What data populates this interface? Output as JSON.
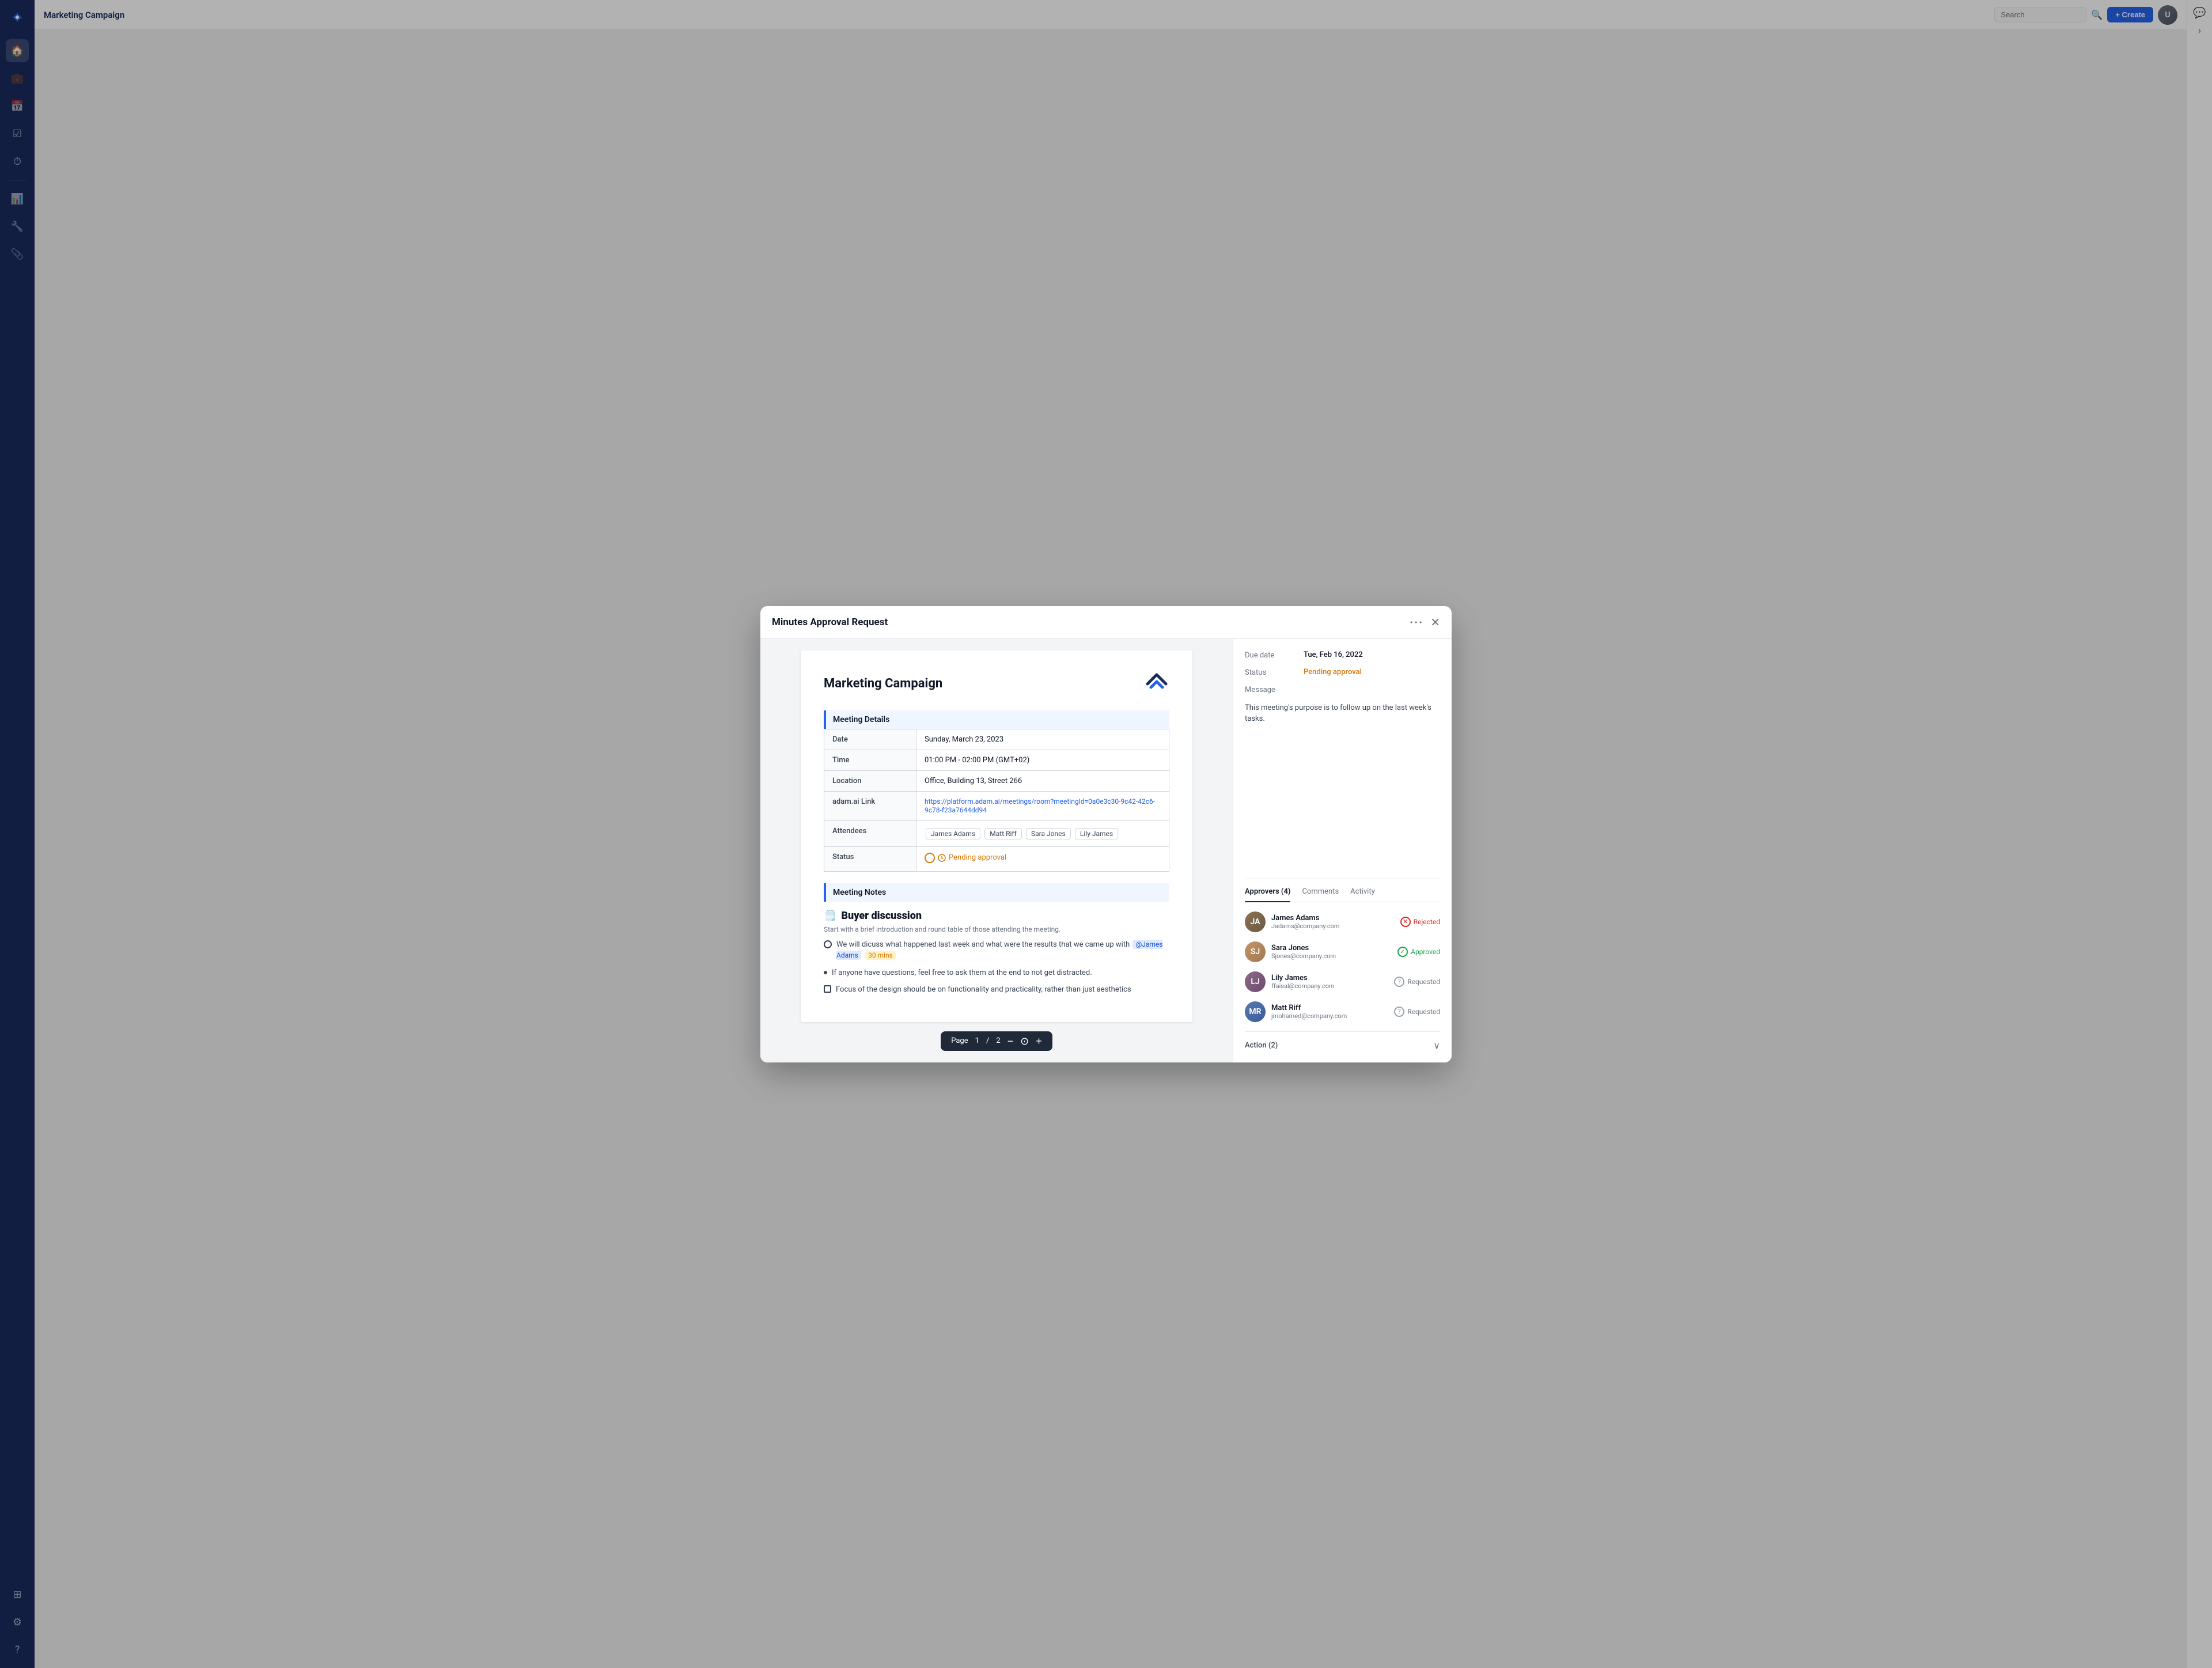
{
  "app": {
    "title": "Marketing Campaign",
    "search_placeholder": "Search",
    "create_btn": "+ Create"
  },
  "sidebar": {
    "items": [
      {
        "id": "home",
        "icon": "⊞",
        "label": "Home"
      },
      {
        "id": "briefcase",
        "icon": "💼",
        "label": "Projects"
      },
      {
        "id": "calendar",
        "icon": "📅",
        "label": "Calendar"
      },
      {
        "id": "tasks",
        "icon": "✓",
        "label": "Tasks"
      },
      {
        "id": "clock",
        "icon": "🕐",
        "label": "Time"
      },
      {
        "id": "chart",
        "icon": "📊",
        "label": "Reports"
      },
      {
        "id": "tool",
        "icon": "🔧",
        "label": "Tools"
      },
      {
        "id": "paperclip",
        "icon": "📎",
        "label": "Files"
      },
      {
        "id": "grid",
        "icon": "⊞",
        "label": "Apps"
      },
      {
        "id": "settings",
        "icon": "⚙",
        "label": "Settings"
      },
      {
        "id": "help",
        "icon": "?",
        "label": "Help"
      }
    ]
  },
  "modal": {
    "title": "Minutes Approval Request",
    "doc": {
      "title": "Marketing Campaign",
      "sections": {
        "meeting_details": "Meeting Details",
        "meeting_notes": "Meeting Notes"
      },
      "fields": {
        "date_label": "Date",
        "date_value": "Sunday, March 23, 2023",
        "time_label": "Time",
        "time_value": "01:00 PM - 02:00 PM (GMT+02)",
        "location_label": "Location",
        "location_value": "Office, Building 13, Street 266",
        "link_label": "adam.ai Link",
        "link_value": "https://platform.adam.ai/meetings/room?meetingId=0a0e3c30-9c42-42c6-9c78-f23a7644dd94",
        "attendees_label": "Attendees",
        "attendees": [
          "James Adams",
          "Matt Riff",
          "Sara Jones",
          "Lily James"
        ],
        "status_label": "Status",
        "status_value": "Pending approval"
      },
      "notes": {
        "section_title": "Meeting Notes",
        "discussion_emoji": "🗒️",
        "discussion_title": "Buyer discussion",
        "intro": "Start with a brief introduction and round table of those attending the meeting.",
        "items": [
          {
            "type": "circle",
            "text": "We will dicuss what happened last week and what were the results that we came up with",
            "mention": "@James Adams",
            "time": "30 mins"
          },
          {
            "type": "bullet",
            "text": "If anyone have questions, feel free to ask them at the end to not get distracted."
          },
          {
            "type": "checkbox",
            "text": "Focus of the design should be on functionality and practicality, rather than just aesthetics"
          }
        ]
      },
      "pagination": {
        "label": "Page",
        "current": "1",
        "separator": "/",
        "total": "2"
      }
    },
    "right_panel": {
      "due_date_label": "Due date",
      "due_date_value": "Tue, Feb 16, 2022",
      "status_label": "Status",
      "status_value": "Pending approval",
      "message_label": "Message",
      "message_text": "This meeting's purpose is to follow up on the last week's tasks.",
      "tabs": [
        "Approvers (4)",
        "Comments",
        "Activity"
      ],
      "active_tab": "Approvers (4)",
      "approvers": [
        {
          "name": "James Adams",
          "email": "Jadams@company.com",
          "status": "Rejected",
          "status_type": "rejected",
          "avatar_initial": "JA"
        },
        {
          "name": "Sara Jones",
          "email": "Sjones@company.com",
          "status": "Approved",
          "status_type": "approved",
          "avatar_initial": "SJ"
        },
        {
          "name": "Lily James",
          "email": "ffaisal@company.com",
          "status": "Requested",
          "status_type": "requested",
          "avatar_initial": "LJ"
        },
        {
          "name": "Matt Riff",
          "email": "jmohamed@company.com",
          "status": "Requested",
          "status_type": "requested",
          "avatar_initial": "MR"
        }
      ],
      "action_label": "Action (2)"
    }
  }
}
